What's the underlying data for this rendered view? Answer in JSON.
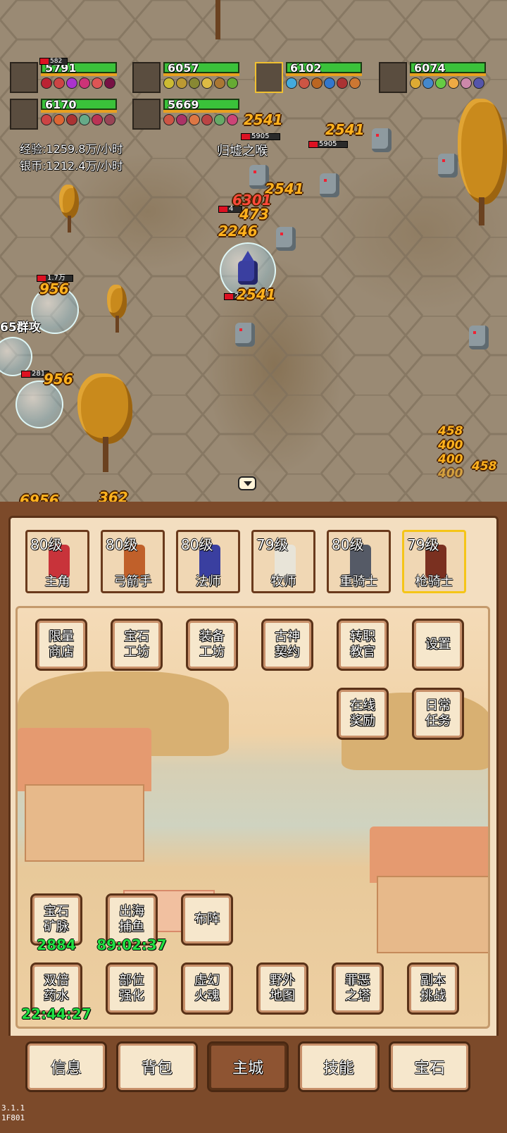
{
  "party": [
    {
      "hp": "5791",
      "extra": "582"
    },
    {
      "hp": "6057"
    },
    {
      "hp": "6102",
      "selected": true
    },
    {
      "hp": "6074"
    },
    {
      "hp": "6170"
    },
    {
      "hp": "5669"
    }
  ],
  "stats": {
    "exp": "经验:1259.8万/小时",
    "silver": "银币:1212.4万/小时"
  },
  "area_title": "归墟之喉",
  "group_attack_label": "65群攻",
  "damage_numbers": {
    "d1": "2541",
    "d2": "2541",
    "d3": "2541",
    "d4": "2541",
    "d5": "6301",
    "d6": "473",
    "d7": "2246",
    "d8": "956",
    "d9": "956",
    "d10": "458",
    "d11": "400",
    "d12": "400",
    "d13": "400",
    "d14": "458",
    "d15": "6956",
    "d16": "362"
  },
  "enemy_hp": {
    "e1": "5905",
    "e2": "5905",
    "e3": "4",
    "e4": "2",
    "e5": "1.7万",
    "e6": "281"
  },
  "classes": [
    {
      "level": "80级",
      "name": "主角",
      "color": "#c8333a"
    },
    {
      "level": "80级",
      "name": "弓箭手",
      "color": "#c0602a"
    },
    {
      "level": "80级",
      "name": "法师",
      "color": "#3a3fa0"
    },
    {
      "level": "79级",
      "name": "牧师",
      "color": "#e8e4d8"
    },
    {
      "level": "80级",
      "name": "重骑士",
      "color": "#555a66"
    },
    {
      "level": "79级",
      "name": "枪骑士",
      "color": "#7a3020",
      "selected": true
    }
  ],
  "menu": {
    "limited_shop": "限量商店",
    "gem_workshop": "宝石工坊",
    "equip_workshop": "装备工坊",
    "ancient_pact": "古神契约",
    "class_change": "转职教官",
    "settings": "设置",
    "online_reward": "在线奖励",
    "daily_tasks": "日常任务",
    "gem_mine": "宝石矿脉",
    "gem_mine_value": "2884",
    "sea_fishing": "出海捕鱼",
    "sea_fishing_timer": "89:02:37",
    "formation": "布阵",
    "double_potion": "双倍药水",
    "double_potion_timer": "22:44:27",
    "part_enhance": "部位强化",
    "phantom_soul": "虚幻火魂",
    "field_map": "野外地图",
    "evil_tower": "罪恶之塔",
    "dungeon": "副本挑战"
  },
  "nav": {
    "info": "信息",
    "bag": "背包",
    "main_city": "主城",
    "skills": "技能",
    "gems": "宝石"
  },
  "version": {
    "line1": "3.1.1",
    "line2": "1F801"
  }
}
